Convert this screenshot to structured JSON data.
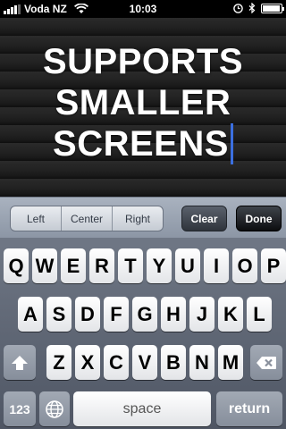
{
  "status_bar": {
    "carrier": "Voda NZ",
    "time": "10:03",
    "battery_level": 0.95,
    "icons": [
      "signal-icon",
      "wifi-icon",
      "alarm-icon",
      "bluetooth-icon",
      "battery-icon"
    ]
  },
  "board": {
    "lines": [
      "SUPPORTS",
      "SMALLER",
      "SCREENS"
    ]
  },
  "toolbar": {
    "alignment": [
      "Left",
      "Center",
      "Right"
    ],
    "clear_label": "Clear",
    "done_label": "Done"
  },
  "keyboard": {
    "row1": [
      "Q",
      "W",
      "E",
      "R",
      "T",
      "Y",
      "U",
      "I",
      "O",
      "P"
    ],
    "row2": [
      "A",
      "S",
      "D",
      "F",
      "G",
      "H",
      "J",
      "K",
      "L"
    ],
    "row3": [
      "Z",
      "X",
      "C",
      "V",
      "B",
      "N",
      "M"
    ],
    "numbers_label": "123",
    "space_label": "space",
    "return_label": "return"
  }
}
